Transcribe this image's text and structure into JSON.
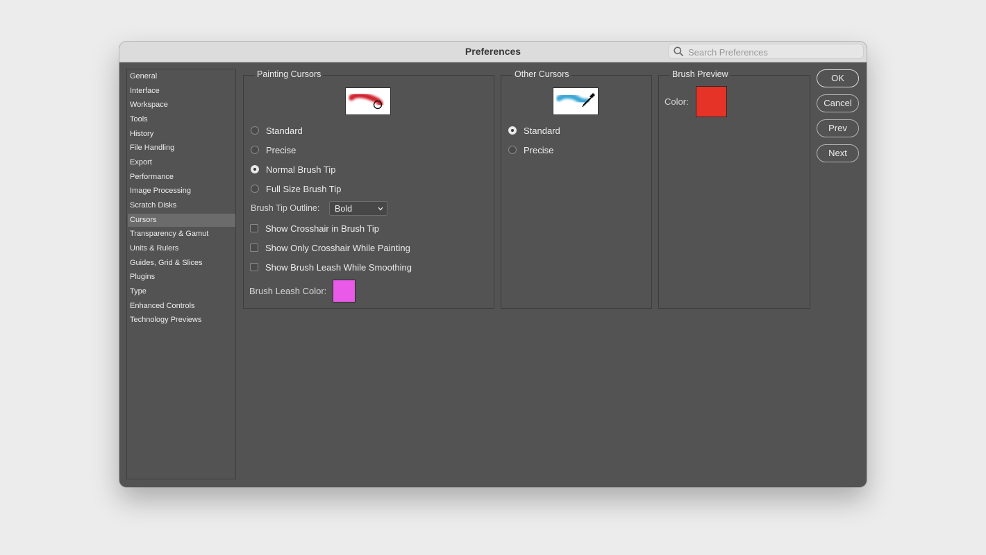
{
  "window": {
    "title": "Preferences"
  },
  "search": {
    "placeholder": "Search Preferences",
    "icon": "search-icon"
  },
  "sidebar": {
    "items": [
      {
        "label": "General"
      },
      {
        "label": "Interface"
      },
      {
        "label": "Workspace"
      },
      {
        "label": "Tools"
      },
      {
        "label": "History"
      },
      {
        "label": "File Handling"
      },
      {
        "label": "Export"
      },
      {
        "label": "Performance"
      },
      {
        "label": "Image Processing"
      },
      {
        "label": "Scratch Disks"
      },
      {
        "label": "Cursors",
        "selected": true
      },
      {
        "label": "Transparency & Gamut"
      },
      {
        "label": "Units & Rulers"
      },
      {
        "label": "Guides, Grid & Slices"
      },
      {
        "label": "Plugins"
      },
      {
        "label": "Type"
      },
      {
        "label": "Enhanced Controls"
      },
      {
        "label": "Technology Previews"
      }
    ]
  },
  "painting": {
    "title": "Painting Cursors",
    "options": {
      "standard": "Standard",
      "precise": "Precise",
      "normal_tip": "Normal Brush Tip",
      "full_tip": "Full Size Brush Tip"
    },
    "selected": "Normal Brush Tip",
    "outline_label": "Brush Tip Outline:",
    "outline_value": "Bold",
    "checkboxes": {
      "crosshair": "Show Crosshair in Brush Tip",
      "only_crosshair": "Show Only Crosshair While Painting",
      "leash": "Show Brush Leash While Smoothing"
    },
    "leash_color_label": "Brush Leash Color:",
    "leash_color": "#ea5ae8"
  },
  "other": {
    "title": "Other Cursors",
    "options": {
      "standard": "Standard",
      "precise": "Precise"
    },
    "selected": "Standard"
  },
  "preview": {
    "title": "Brush Preview",
    "color_label": "Color:",
    "color": "#e63328"
  },
  "buttons": {
    "ok": "OK",
    "cancel": "Cancel",
    "prev": "Prev",
    "next": "Next"
  }
}
